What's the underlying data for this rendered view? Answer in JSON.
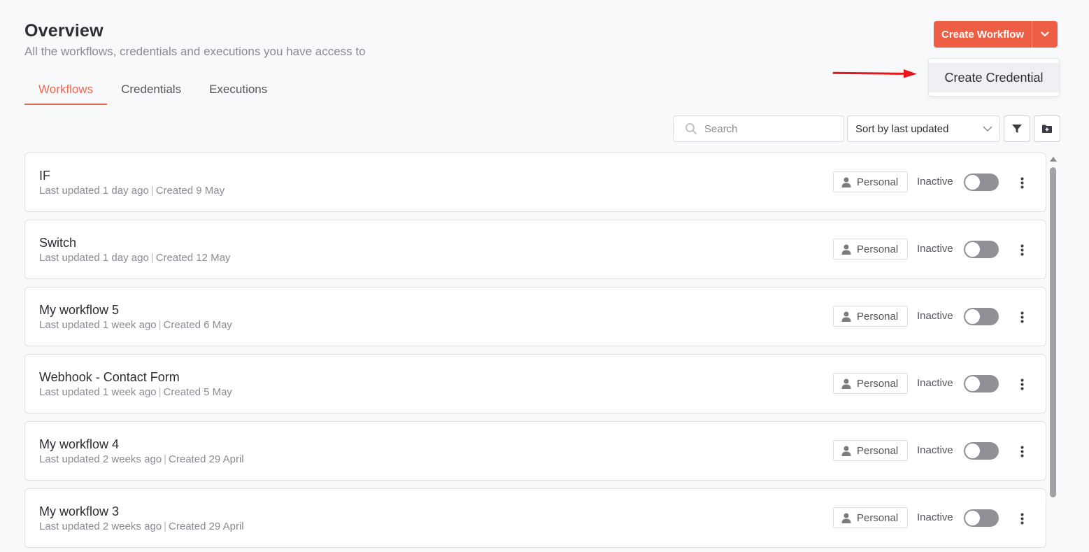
{
  "header": {
    "title": "Overview",
    "subtitle": "All the workflows, credentials and executions you have access to"
  },
  "tabs": [
    {
      "label": "Workflows",
      "active": true
    },
    {
      "label": "Credentials",
      "active": false
    },
    {
      "label": "Executions",
      "active": false
    }
  ],
  "create": {
    "button_label": "Create Workflow",
    "dropdown_item": "Create Credential"
  },
  "toolbar": {
    "search_placeholder": "Search",
    "sort_value": "Sort by last updated"
  },
  "workflows": [
    {
      "name": "IF",
      "updated": "Last updated 1 day ago",
      "created": "Created 9 May",
      "owner": "Personal",
      "status": "Inactive"
    },
    {
      "name": "Switch",
      "updated": "Last updated 1 day ago",
      "created": "Created 12 May",
      "owner": "Personal",
      "status": "Inactive"
    },
    {
      "name": "My workflow 5",
      "updated": "Last updated 1 week ago",
      "created": "Created 6 May",
      "owner": "Personal",
      "status": "Inactive"
    },
    {
      "name": "Webhook - Contact Form",
      "updated": "Last updated 1 week ago",
      "created": "Created 5 May",
      "owner": "Personal",
      "status": "Inactive"
    },
    {
      "name": "My workflow 4",
      "updated": "Last updated 2 weeks ago",
      "created": "Created 29 April",
      "owner": "Personal",
      "status": "Inactive"
    },
    {
      "name": "My workflow 3",
      "updated": "Last updated 2 weeks ago",
      "created": "Created 29 April",
      "owner": "Personal",
      "status": "Inactive"
    }
  ],
  "colors": {
    "accent": "#ee5e45",
    "active_tab": "#ea6a55",
    "annotation_arrow": "#e8161b"
  },
  "icons": [
    "search-icon",
    "chevron-down-icon",
    "filter-icon",
    "folder-plus-icon",
    "person-icon",
    "kebab-icon",
    "annotation-arrow"
  ]
}
